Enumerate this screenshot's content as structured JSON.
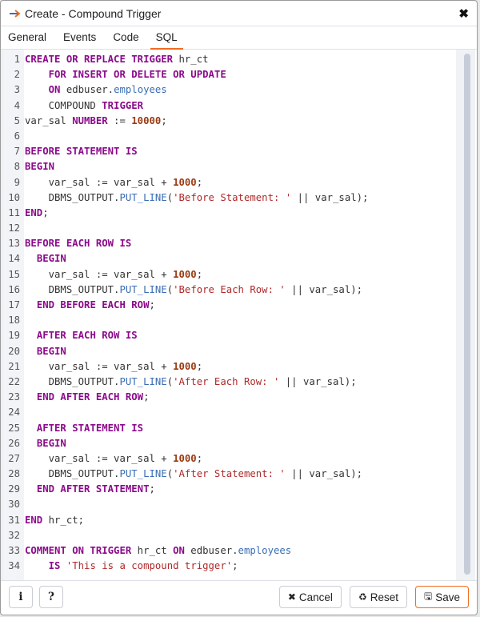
{
  "window": {
    "title": "Create - Compound Trigger",
    "close_icon": "close-icon"
  },
  "tabs": [
    {
      "label": "General",
      "active": false
    },
    {
      "label": "Events",
      "active": false
    },
    {
      "label": "Code",
      "active": false
    },
    {
      "label": "SQL",
      "active": true
    }
  ],
  "editor": {
    "lines": [
      [
        [
          "kw",
          "CREATE OR REPLACE TRIGGER"
        ],
        [
          "tx",
          " hr_ct"
        ]
      ],
      [
        [
          "tx",
          "    "
        ],
        [
          "kw",
          "FOR INSERT OR DELETE OR UPDATE"
        ]
      ],
      [
        [
          "tx",
          "    "
        ],
        [
          "kw",
          "ON"
        ],
        [
          "tx",
          " edbuser."
        ],
        [
          "prop",
          "employees"
        ]
      ],
      [
        [
          "tx",
          "    COMPOUND "
        ],
        [
          "kw",
          "TRIGGER"
        ]
      ],
      [
        [
          "tx",
          "var_sal "
        ],
        [
          "kw",
          "NUMBER"
        ],
        [
          "tx",
          " := "
        ],
        [
          "num",
          "10000"
        ],
        [
          "tx",
          ";"
        ]
      ],
      [],
      [
        [
          "kw",
          "BEFORE STATEMENT IS"
        ]
      ],
      [
        [
          "kw",
          "BEGIN"
        ]
      ],
      [
        [
          "tx",
          "    var_sal := var_sal + "
        ],
        [
          "num",
          "1000"
        ],
        [
          "tx",
          ";"
        ]
      ],
      [
        [
          "tx",
          "    DBMS_OUTPUT."
        ],
        [
          "prop",
          "PUT_LINE"
        ],
        [
          "tx",
          "("
        ],
        [
          "str",
          "'Before Statement: '"
        ],
        [
          "tx",
          " || var_sal);"
        ]
      ],
      [
        [
          "kw",
          "END"
        ],
        [
          "tx",
          ";"
        ]
      ],
      [],
      [
        [
          "kw",
          "BEFORE EACH ROW IS"
        ]
      ],
      [
        [
          "tx",
          "  "
        ],
        [
          "kw",
          "BEGIN"
        ]
      ],
      [
        [
          "tx",
          "    var_sal := var_sal + "
        ],
        [
          "num",
          "1000"
        ],
        [
          "tx",
          ";"
        ]
      ],
      [
        [
          "tx",
          "    DBMS_OUTPUT."
        ],
        [
          "prop",
          "PUT_LINE"
        ],
        [
          "tx",
          "("
        ],
        [
          "str",
          "'Before Each Row: '"
        ],
        [
          "tx",
          " || var_sal);"
        ]
      ],
      [
        [
          "tx",
          "  "
        ],
        [
          "kw",
          "END BEFORE EACH ROW"
        ],
        [
          "tx",
          ";"
        ]
      ],
      [],
      [
        [
          "tx",
          "  "
        ],
        [
          "kw",
          "AFTER EACH ROW IS"
        ]
      ],
      [
        [
          "tx",
          "  "
        ],
        [
          "kw",
          "BEGIN"
        ]
      ],
      [
        [
          "tx",
          "    var_sal := var_sal + "
        ],
        [
          "num",
          "1000"
        ],
        [
          "tx",
          ";"
        ]
      ],
      [
        [
          "tx",
          "    DBMS_OUTPUT."
        ],
        [
          "prop",
          "PUT_LINE"
        ],
        [
          "tx",
          "("
        ],
        [
          "str",
          "'After Each Row: '"
        ],
        [
          "tx",
          " || var_sal);"
        ]
      ],
      [
        [
          "tx",
          "  "
        ],
        [
          "kw",
          "END AFTER EACH ROW"
        ],
        [
          "tx",
          ";"
        ]
      ],
      [],
      [
        [
          "tx",
          "  "
        ],
        [
          "kw",
          "AFTER STATEMENT IS"
        ]
      ],
      [
        [
          "tx",
          "  "
        ],
        [
          "kw",
          "BEGIN"
        ]
      ],
      [
        [
          "tx",
          "    var_sal := var_sal + "
        ],
        [
          "num",
          "1000"
        ],
        [
          "tx",
          ";"
        ]
      ],
      [
        [
          "tx",
          "    DBMS_OUTPUT."
        ],
        [
          "prop",
          "PUT_LINE"
        ],
        [
          "tx",
          "("
        ],
        [
          "str",
          "'After Statement: '"
        ],
        [
          "tx",
          " || var_sal);"
        ]
      ],
      [
        [
          "tx",
          "  "
        ],
        [
          "kw",
          "END AFTER STATEMENT"
        ],
        [
          "tx",
          ";"
        ]
      ],
      [],
      [
        [
          "kw",
          "END"
        ],
        [
          "tx",
          " hr_ct;"
        ]
      ],
      [],
      [
        [
          "kw",
          "COMMENT ON TRIGGER"
        ],
        [
          "tx",
          " hr_ct "
        ],
        [
          "kw",
          "ON"
        ],
        [
          "tx",
          " edbuser."
        ],
        [
          "prop",
          "employees"
        ]
      ],
      [
        [
          "tx",
          "    "
        ],
        [
          "kw",
          "IS"
        ],
        [
          "tx",
          " "
        ],
        [
          "str",
          "'This is a compound trigger'"
        ],
        [
          "tx",
          ";"
        ]
      ]
    ]
  },
  "footer": {
    "info_label": "i",
    "help_label": "?",
    "cancel_label": "Cancel",
    "reset_label": "Reset",
    "save_label": "Save",
    "cancel_icon": "✖",
    "reset_icon": "♻",
    "save_icon": "🖫"
  },
  "colors": {
    "accent": "#ef6c20",
    "keyword": "#8b0a8b",
    "number": "#9b3a12",
    "property": "#3a6db4",
    "string": "#b02a2a"
  }
}
